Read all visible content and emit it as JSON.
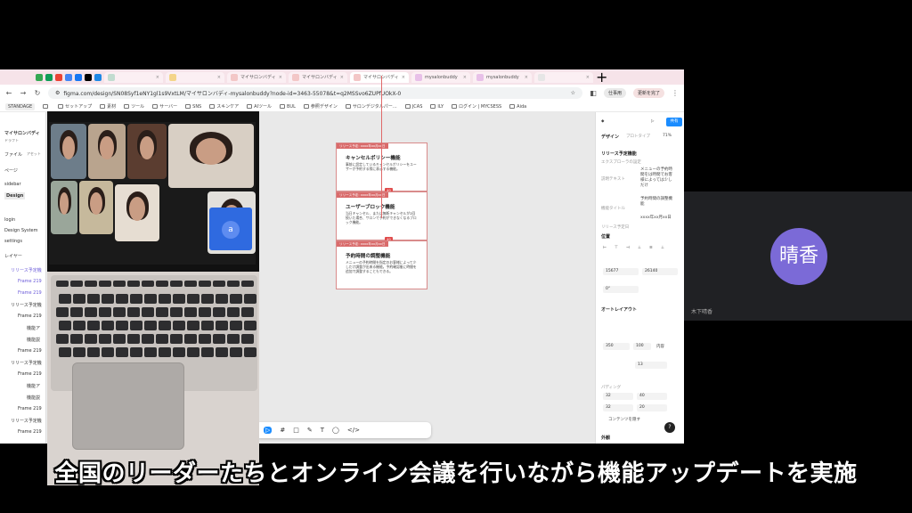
{
  "browser": {
    "tabs": [
      {
        "label": "",
        "color": "#c2dcd0"
      },
      {
        "label": "",
        "color": "#f4d58a"
      },
      {
        "label": "マイサロンバディ",
        "color": "#f3c7c7"
      },
      {
        "label": "マイサロンバディ",
        "color": "#f3c7c7"
      },
      {
        "label": "マイサロンバディ",
        "color": "#f3c7c7",
        "active": true
      },
      {
        "label": "mysalonbuddy",
        "color": "#e8c0e8"
      },
      {
        "label": "mysalonbuddy",
        "color": "#e8c0e8"
      },
      {
        "label": "",
        "color": "#e6e6e6"
      }
    ],
    "url": "figma.com/design/SN08Syf1eNY1gl1s9VxtLM/マイサロンバディ-mysalonbuddy?node-id=3463-55078&t=q2MSSvo6ZUPfUOkX-0",
    "user_pill": "仕事用",
    "update_pill": "更新を完了",
    "bookmarks": [
      "STANDAGE",
      "",
      "セットアップ",
      "素材",
      "ツール",
      "サーバー",
      "SNS",
      "スキンケア",
      "AIツール",
      "BUL",
      "参照デザイン",
      "サロンデジタルパー…",
      "JCAS",
      "ILY",
      "ログイン | MYCSESS",
      "Aida"
    ]
  },
  "figma": {
    "file_title": "マイサロンバディ",
    "file_sub": "ドラフト",
    "tabs": [
      "ファイル",
      "アセット"
    ],
    "pages_label": "ページ",
    "pages": [
      "sidebar",
      "Design"
    ],
    "pages2": [
      "login",
      "Design System",
      "settings"
    ],
    "layers_label": "レイヤー",
    "layers": [
      {
        "label": "リリース予定機",
        "style": "blue"
      },
      {
        "label": "Frame 219",
        "style": "blue"
      },
      {
        "label": "Frame 219",
        "style": "blue"
      },
      {
        "label": "リリース予定機",
        "style": "normal"
      },
      {
        "label": "Frame 219",
        "style": "normal"
      },
      {
        "label": "機能ア",
        "style": "normal"
      },
      {
        "label": "機能説",
        "style": "normal"
      },
      {
        "label": "Frame 219",
        "style": "normal"
      },
      {
        "label": "リリース予定機",
        "style": "normal"
      },
      {
        "label": "Frame 219",
        "style": "normal"
      },
      {
        "label": "機能ア",
        "style": "normal"
      },
      {
        "label": "機能説",
        "style": "normal"
      },
      {
        "label": "Frame 219",
        "style": "normal"
      },
      {
        "label": "リリース予定機",
        "style": "normal"
      },
      {
        "label": "Frame 219",
        "style": "normal"
      }
    ],
    "frames": [
      {
        "tag": "リリース予定: xxxx年xx月xx日",
        "title": "キャンセルポリシー機能",
        "body": "事前に設定しているキャンセルポリシーをユーザーが予約する際に表示する機能。",
        "badge": "40"
      },
      {
        "tag": "リリース予定: xxxx年xx月xx日",
        "title": "ユーザーブロック機能",
        "body": "当日キャンセル、または無断キャンセルが2回続いた場合、サロンで予約ができなくなるブロック機能。",
        "badge": "40"
      },
      {
        "tag": "リリース予定: xxxx年xx月xx日",
        "title": "予約時間の調整機能",
        "body": "メニューの予約時間を指定のお客様によって少しだけ調整が出来る機能。予約確認後に時間を追加で調整することもできる。",
        "badge": ""
      }
    ],
    "right_panel": {
      "share": "共有",
      "tabs": [
        "デザイン",
        "プロトタイプ"
      ],
      "zoom": "71%",
      "component_name": "リリース予定機能",
      "component_sub": "エクスプローラの設定",
      "props": [
        {
          "label": "説明テキスト",
          "value": "メニューの予約時間をは時間でお客様によっては少しだけ"
        },
        {
          "label": "機能タイトル",
          "value": "予約時間の調整機能"
        },
        {
          "label": "リリース予定日",
          "value": "xxxx年xx月xx日"
        }
      ],
      "position_label": "位置",
      "x": "15677",
      "y": "26140",
      "rotation": "0°",
      "autolayout_label": "オートレイアウト",
      "width": "350",
      "height": "100",
      "hug": "内容",
      "gap": "13",
      "padding_label": "パディング",
      "pad": [
        "32",
        "40",
        "32",
        "20"
      ],
      "clip_label": "コンテンツを隠す",
      "appearance_label": "外観",
      "help": "?"
    },
    "toolbar": [
      "▷",
      "#",
      "□",
      "✎",
      "T",
      "◯",
      "</>"
    ]
  },
  "meet": {
    "avatar_text": "晴香",
    "avatar_color": "#7b6ad7",
    "tile_name": "木下晴香"
  },
  "camera": {
    "presenter_initial": "a"
  },
  "subtitle": "全国のリーダーたちとオンライン会議を行いながら機能アップデートを実施"
}
